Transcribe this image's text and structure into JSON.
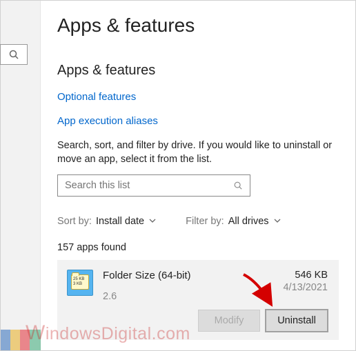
{
  "page": {
    "title": "Apps & features",
    "section_title": "Apps & features"
  },
  "links": {
    "optional_features": "Optional features",
    "app_execution_aliases": "App execution aliases"
  },
  "description": "Search, sort, and filter by drive. If you would like to uninstall or move an app, select it from the list.",
  "search": {
    "placeholder": "Search this list"
  },
  "sort": {
    "label": "Sort by:",
    "value": "Install date"
  },
  "filter": {
    "label": "Filter by:",
    "value": "All drives"
  },
  "app_count": "157 apps found",
  "app": {
    "name": "Folder Size (64-bit)",
    "version": "2.6",
    "size": "546 KB",
    "date": "4/13/2021",
    "icon_line1": "25 KB",
    "icon_line2": "3 KB"
  },
  "buttons": {
    "modify": "Modify",
    "uninstall": "Uninstall"
  },
  "watermark": "indowsDigital.com",
  "watermark_w": "W"
}
